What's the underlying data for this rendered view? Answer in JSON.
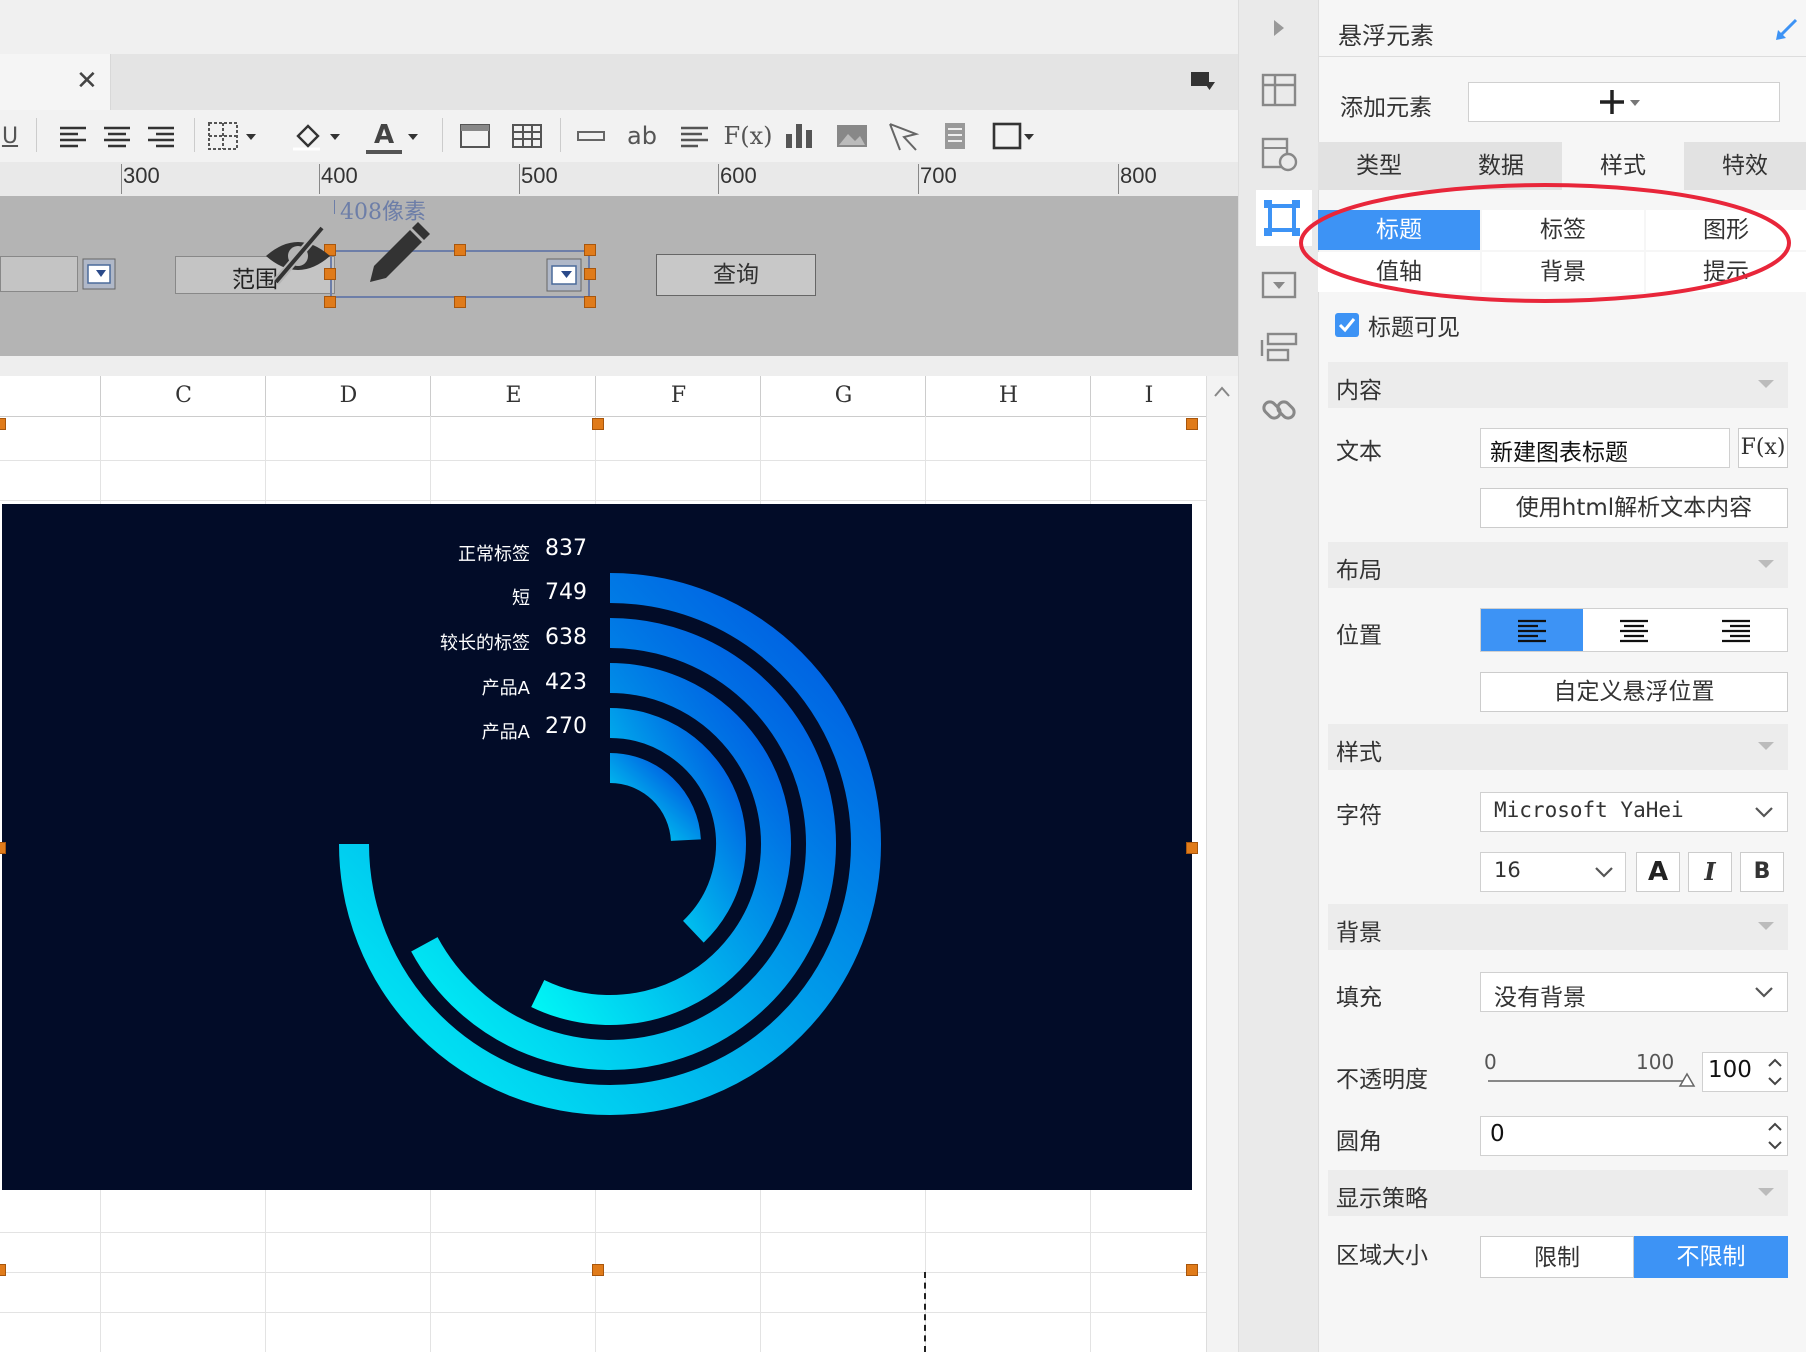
{
  "editor": {
    "ruler_labels": [
      "300",
      "400",
      "500",
      "600",
      "700",
      "800"
    ],
    "size_hint": "408像素",
    "param_label_range": "范围",
    "query_button": "查询",
    "column_headers": [
      "C",
      "D",
      "E",
      "F",
      "G",
      "H",
      "I"
    ],
    "toolbar_text_ab": "ab",
    "toolbar_text_fx": "F(x)",
    "toolbar_text_u": "U",
    "toolbar_text_a": "A"
  },
  "chart_data": {
    "type": "radial-bar",
    "max": 837,
    "items": [
      {
        "label": "正常标签",
        "value": 837
      },
      {
        "label": "短",
        "value": 749
      },
      {
        "label": "较长的标签",
        "value": 638
      },
      {
        "label": "产品A",
        "value": 423
      },
      {
        "label": "产品A",
        "value": 270
      }
    ],
    "colors": {
      "background": "#020c28",
      "start": "#0050e0",
      "end": "#00f5f5"
    }
  },
  "panel": {
    "title": "悬浮元素",
    "add_element_label": "添加元素",
    "tabs": [
      "类型",
      "数据",
      "样式",
      "特效"
    ],
    "active_tab": "样式",
    "subtabs": [
      "标题",
      "标签",
      "图形",
      "值轴",
      "背景",
      "提示"
    ],
    "active_subtab": "标题",
    "title_visible_label": "标题可见",
    "sections": {
      "content": "内容",
      "layout": "布局",
      "style": "样式",
      "background": "背景",
      "display": "显示策略"
    },
    "text_label": "文本",
    "text_value": "新建图表标题",
    "fx_button": "F(x)",
    "html_button": "使用html解析文本内容",
    "position_label": "位置",
    "custom_position_button": "自定义悬浮位置",
    "font_label": "字符",
    "font_value": "Microsoft YaHei",
    "font_size": "16",
    "bold_label": "B",
    "italic_label": "I",
    "color_label": "A",
    "fill_label": "填充",
    "fill_value": "没有背景",
    "opacity_label": "不透明度",
    "opacity_min": "0",
    "opacity_max": "100",
    "opacity_value": "100",
    "radius_label": "圆角",
    "radius_value": "0",
    "area_label": "区域大小",
    "area_options": [
      "限制",
      "不限制"
    ],
    "area_active": "不限制",
    "accent": "#3d93f5",
    "highlight": "#e8263a"
  }
}
